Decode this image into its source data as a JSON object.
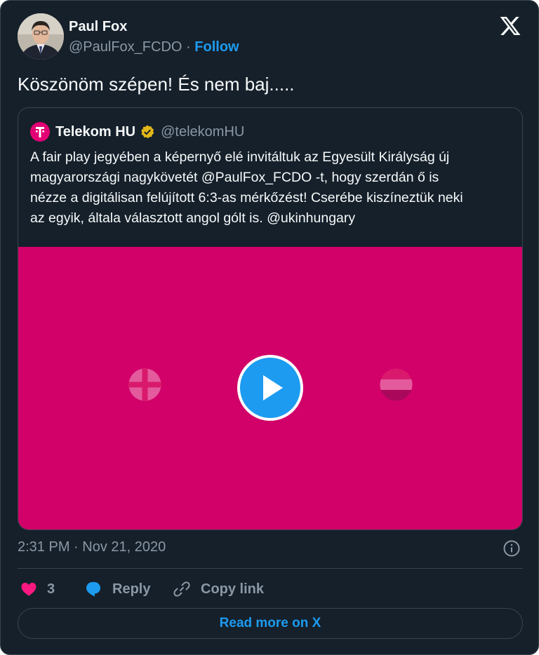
{
  "author": {
    "name": "Paul Fox",
    "handle": "@PaulFox_FCDO",
    "separator": "·",
    "follow_label": "Follow"
  },
  "tweet": {
    "text": "Köszönöm szépen! És nem baj....."
  },
  "quoted": {
    "name": "Telekom HU",
    "handle": "@telekomHU",
    "verified": true,
    "lines": [
      "A fair play jegyében a képernyő elé invitáltuk az Egyesült Királyság új",
      "magyarországi nagykövetét @PaulFox_FCDO -t, hogy szerdán ő is",
      "nézze a digitálisan felújított 6:3-as mérkőzést! Cserébe kiszíneztük neki",
      "az egyik, általa választott angol gólt is. @ukinhungary"
    ],
    "media": {
      "type": "video",
      "background_color": "#d20069"
    }
  },
  "timestamp": "2:31 PM · Nov 21, 2020",
  "actions": {
    "like_count": "3",
    "reply_label": "Reply",
    "copy_label": "Copy link"
  },
  "read_more_label": "Read more on X",
  "colors": {
    "background": "#15202b",
    "accent": "#1d9bf0",
    "like": "#f91880",
    "telekom": "#e20074"
  },
  "icons": [
    "x-logo-icon",
    "telekom-logo-icon",
    "verified-badge-icon",
    "play-icon",
    "info-icon",
    "heart-icon",
    "reply-bubble-icon",
    "link-icon"
  ]
}
